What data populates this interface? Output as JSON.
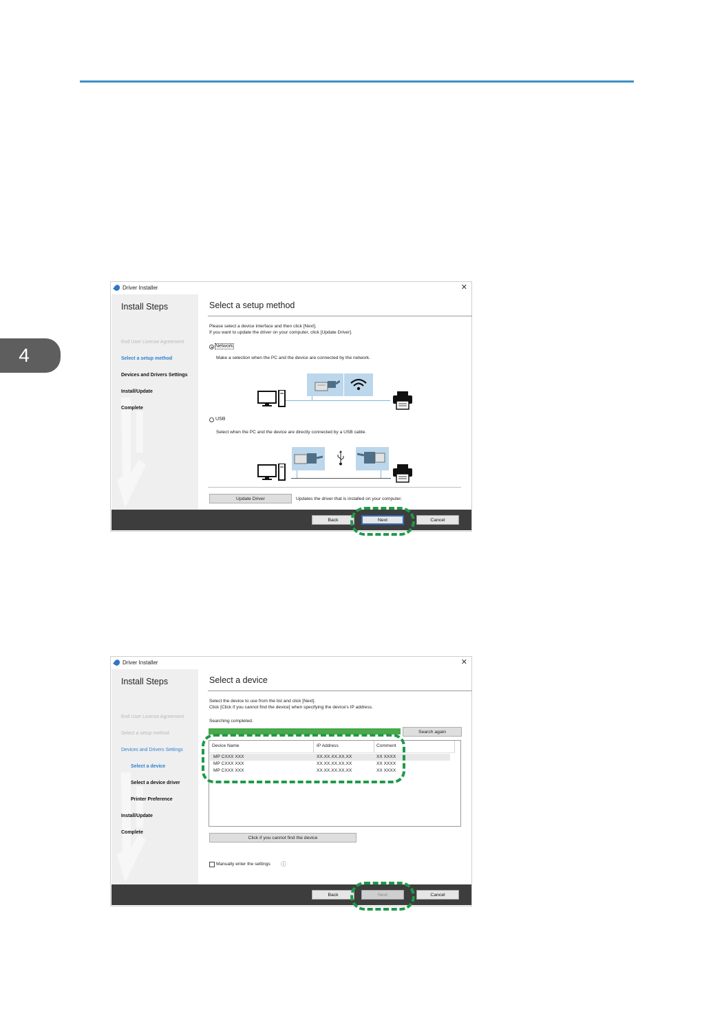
{
  "page": {
    "chapter_number": "4"
  },
  "window1": {
    "title": "Driver Installer",
    "sidebar_title": "Install Steps",
    "steps": [
      "End User License Agreement",
      "Select a setup method",
      "Devices and Drivers Settings",
      "Install/Update",
      "Complete"
    ],
    "heading": "Select a setup method",
    "instruction_line1": "Please select a device interface and then click [Next].",
    "instruction_line2": "If you want to update the driver on your computer, click [Update Driver].",
    "network_label": "Network",
    "network_desc": "Make a selection when the PC and the device are connected by the network.",
    "usb_label": "USB",
    "usb_desc": "Select when the PC and the device are directly connected by a USB cable.",
    "update_driver_button": "Update Driver",
    "update_driver_desc": "Updates the driver that is installed on your computer.",
    "back_button": "Back",
    "next_button": "Next",
    "cancel_button": "Cancel",
    "network_selected": true
  },
  "window2": {
    "title": "Driver Installer",
    "sidebar_title": "Install Steps",
    "steps": [
      "End User License Agreement",
      "Select a setup method",
      "Devices and Drivers Settings",
      "Select a device",
      "Select a device driver",
      "Printer Preference",
      "Install/Update",
      "Complete"
    ],
    "heading": "Select a device",
    "instruction_line1": "Select the device to use from the list and click [Next].",
    "instruction_line2": "Click [Click if you cannot find the device] when specifying the device's IP address.",
    "status": "Searching completed.",
    "search_again_button": "Search again",
    "columns": [
      "Device Name",
      "IP Address",
      "Comment"
    ],
    "rows": [
      [
        "MP CXXX XXX",
        "XX.XX.XX.XX.XX",
        "XX XXXX"
      ],
      [
        "MP CXXX XXX",
        "XX.XX.XX.XX.XX",
        "XX XXXX"
      ],
      [
        "MP CXXX XXX",
        "XX.XX.XX.XX.XX",
        "XX XXXX"
      ]
    ],
    "cannot_find_button": "Click if you cannot find the device",
    "manual_checkbox_label": "Manually enter the settings",
    "info_icon": "ⓘ",
    "back_button": "Back",
    "next_button": "Next",
    "cancel_button": "Cancel",
    "manual_checked": false
  },
  "colors": {
    "accent_rule": "#3b8fc4",
    "highlight_dash": "#1f9a48",
    "progress": "#49a84a",
    "active_step": "#2f7fd0"
  }
}
